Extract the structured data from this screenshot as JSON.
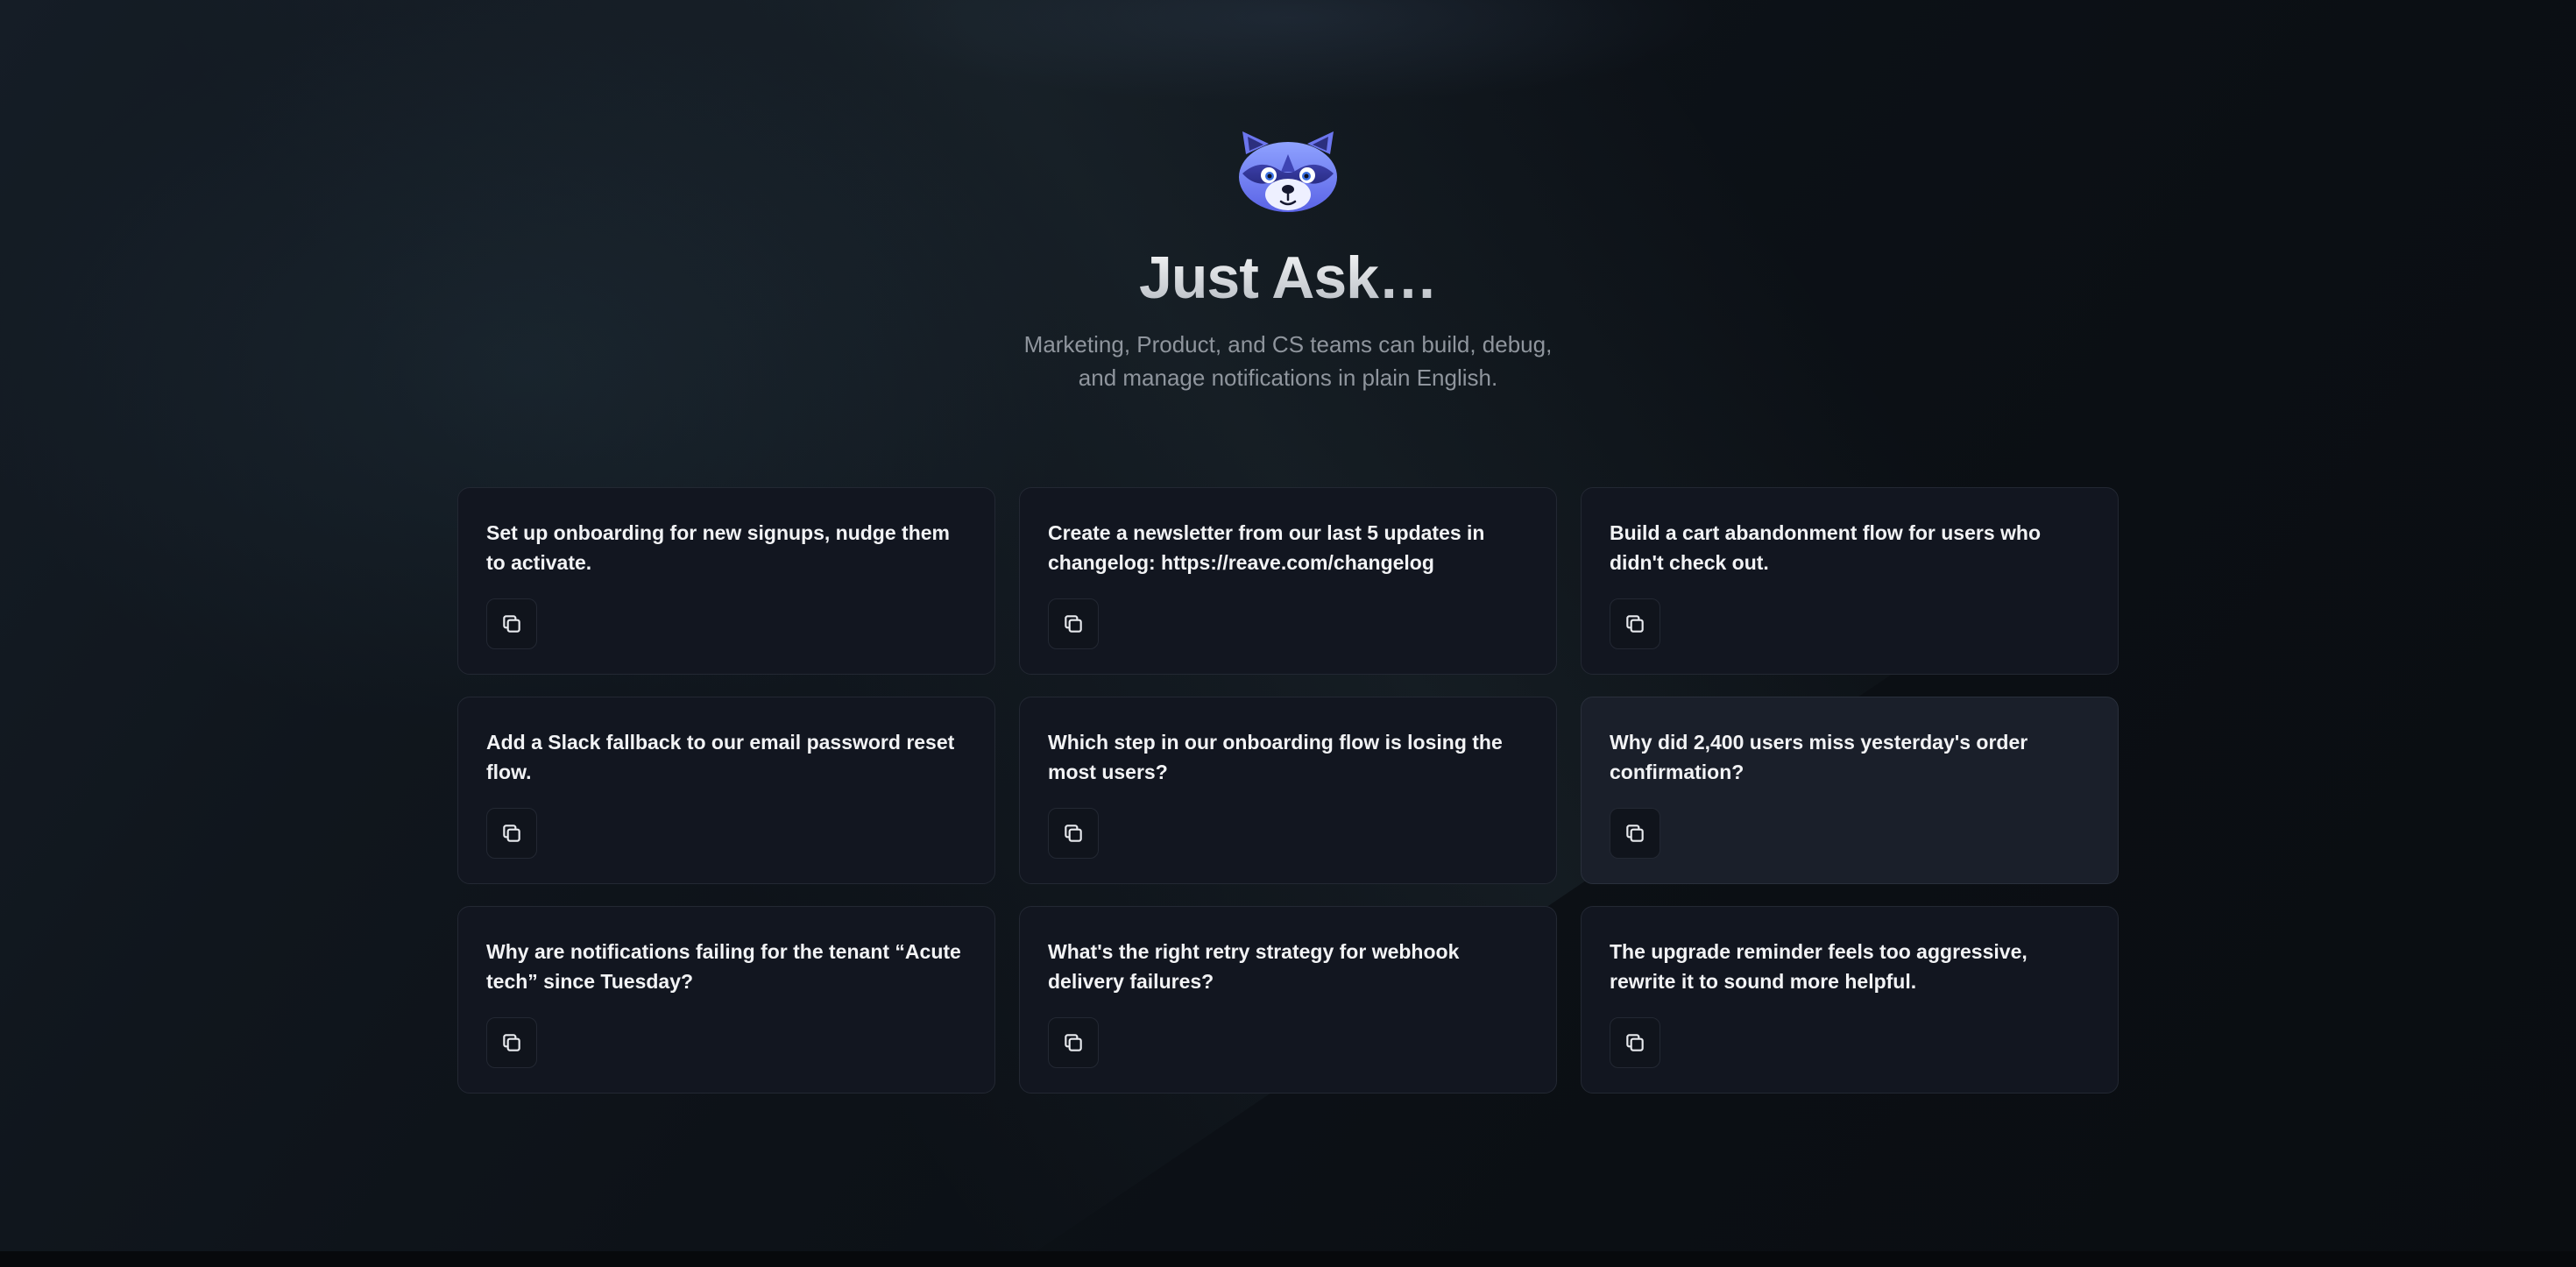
{
  "header": {
    "mascot_icon": "raccoon-icon",
    "title": "Just Ask…",
    "subtitle_lines": [
      "Marketing, Product, and CS teams can build, debug,",
      "and manage notifications in plain English."
    ]
  },
  "prompts": [
    {
      "text": "Set up onboarding for new signups, nudge them to activate.",
      "action_icon": "copy-icon"
    },
    {
      "text": "Create a newsletter from our last 5 updates in changelog: https://reave.com/changelog",
      "action_icon": "copy-icon"
    },
    {
      "text": "Build a cart abandonment flow for users who didn't check out.",
      "action_icon": "copy-icon"
    },
    {
      "text": "Add a Slack fallback to our email password reset flow.",
      "action_icon": "copy-icon"
    },
    {
      "text": "Which step in our onboarding flow is losing the most users?",
      "action_icon": "copy-icon"
    },
    {
      "text": "Why did 2,400 users miss yesterday's order confirmation?",
      "action_icon": "copy-icon"
    },
    {
      "text": "Why are notifications failing for the tenant “Acute tech” since Tuesday?",
      "action_icon": "copy-icon"
    },
    {
      "text": "What's the right retry strategy for webhook delivery failures?",
      "action_icon": "copy-icon"
    },
    {
      "text": "The upgrade reminder feels too aggressive, rewrite it to sound more helpful.",
      "action_icon": "copy-icon"
    }
  ],
  "colors": {
    "background": "#0b0e13",
    "card": "#121620",
    "card_hover": "#1a1f2a",
    "card_border": "#232833",
    "text_primary": "#f2f3f5",
    "text_muted": "#8f959d"
  }
}
